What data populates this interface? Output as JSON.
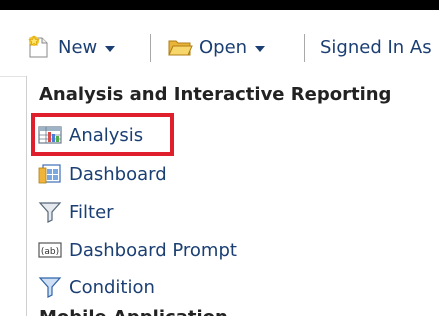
{
  "toolbar": {
    "new_label": "New",
    "open_label": "Open",
    "signed_in_label": "Signed In As"
  },
  "menu": {
    "section_heading": "Analysis and Interactive Reporting",
    "items": [
      {
        "label": "Analysis",
        "icon": "analysis-grid-icon"
      },
      {
        "label": "Dashboard",
        "icon": "dashboard-icon"
      },
      {
        "label": "Filter",
        "icon": "filter-funnel-icon"
      },
      {
        "label": "Dashboard Prompt",
        "icon": "prompt-ab-icon"
      },
      {
        "label": "Condition",
        "icon": "condition-funnel-icon"
      }
    ],
    "next_heading_partial": "Mobile Application"
  },
  "highlight": {
    "color": "#e01f2d",
    "target": "Analysis"
  },
  "colors": {
    "link_text": "#1b3f73",
    "heading_text": "#222222",
    "topbar": "#000000"
  }
}
